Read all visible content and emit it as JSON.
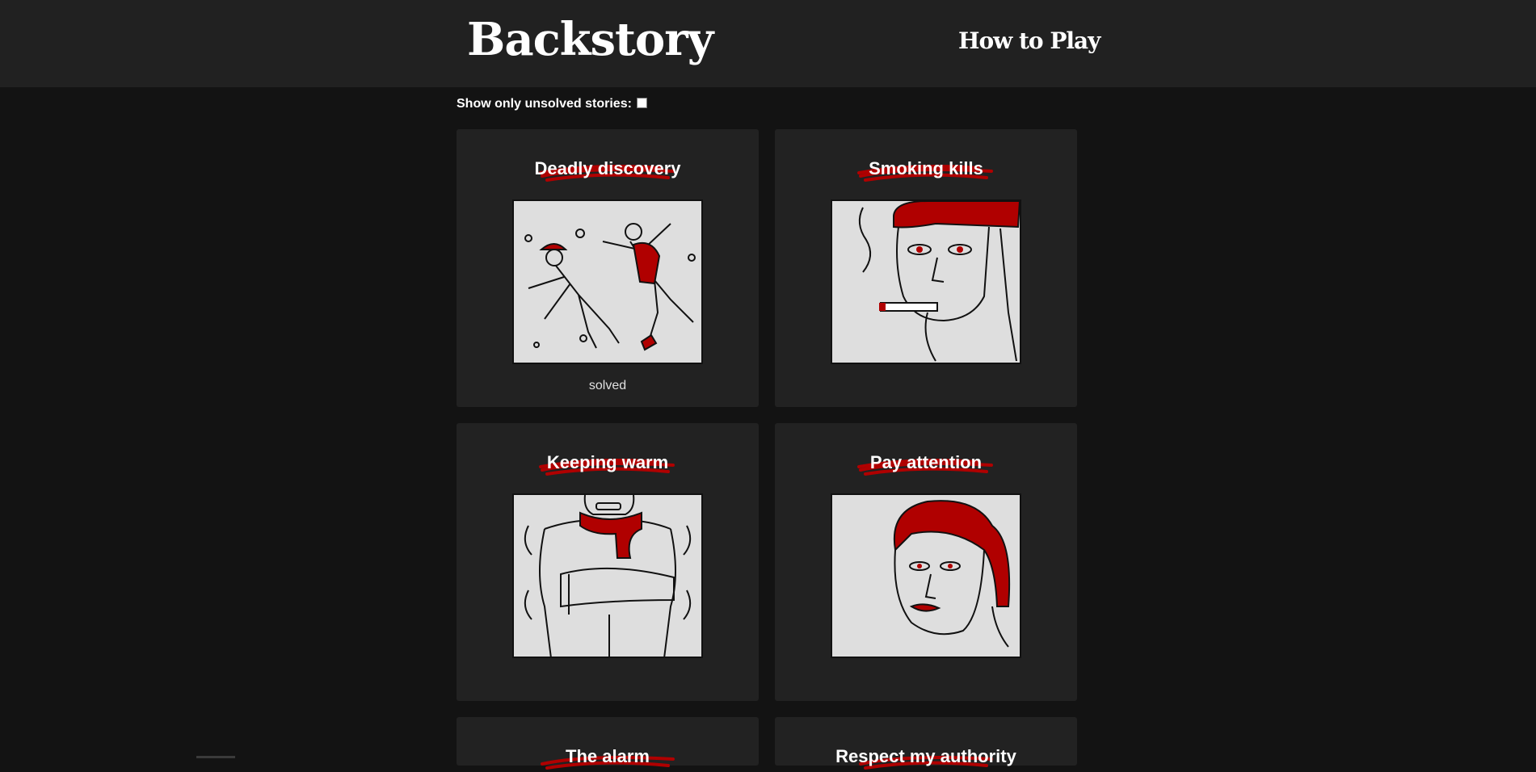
{
  "header": {
    "logo": "Backstory",
    "how_to_play": "How to Play"
  },
  "filter": {
    "label": "Show only unsolved stories:",
    "checked": false
  },
  "stories": [
    {
      "title": "Deadly discovery",
      "status": "solved",
      "art": "two-falling-figures"
    },
    {
      "title": "Smoking kills",
      "status": "",
      "art": "man-smoking-cap"
    },
    {
      "title": "Keeping warm",
      "status": "",
      "art": "man-with-scarf"
    },
    {
      "title": "Pay attention",
      "status": "",
      "art": "woman-red-hair"
    },
    {
      "title": "The alarm",
      "status": "",
      "art": ""
    },
    {
      "title": "Respect my authority",
      "status": "",
      "art": ""
    }
  ],
  "colors": {
    "accent_red": "#b00000",
    "card_bg": "#222222",
    "page_bg": "#131313",
    "header_bg": "#212121",
    "art_bg": "#dedede"
  }
}
